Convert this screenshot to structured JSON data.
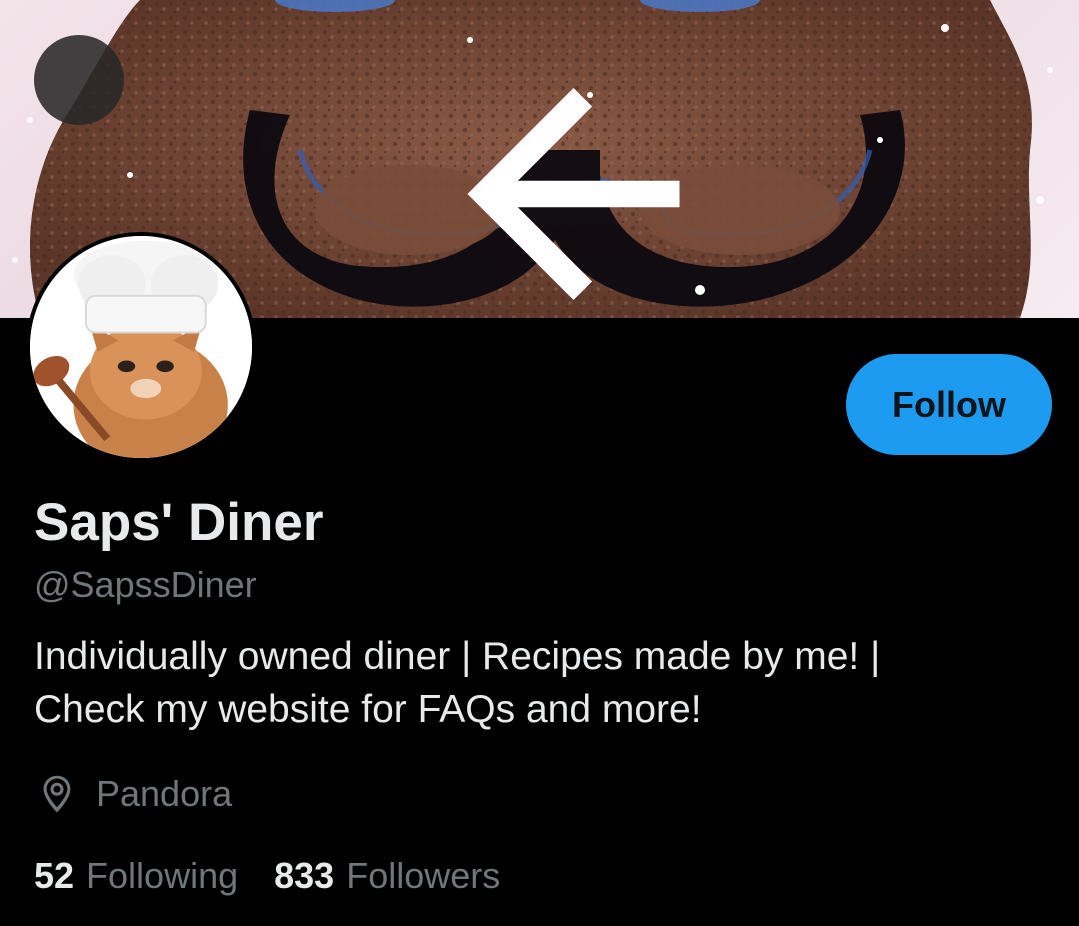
{
  "profile": {
    "display_name": "Saps' Diner",
    "handle": "@SapssDiner",
    "bio_lines": [
      "Individually owned diner | Recipes made by me! |",
      "Check my website for FAQs and more!"
    ],
    "location": "Pandora",
    "following_count": "52",
    "following_label": "Following",
    "followers_count": "833",
    "followers_label": "Followers"
  },
  "actions": {
    "follow_label": "Follow"
  },
  "icons": {
    "back": "arrow-left-icon",
    "location": "location-pin-icon"
  },
  "colors": {
    "accent": "#1d9bf0",
    "background": "#000000",
    "primary_text": "#e7e9ea",
    "secondary_text": "#71767b"
  }
}
